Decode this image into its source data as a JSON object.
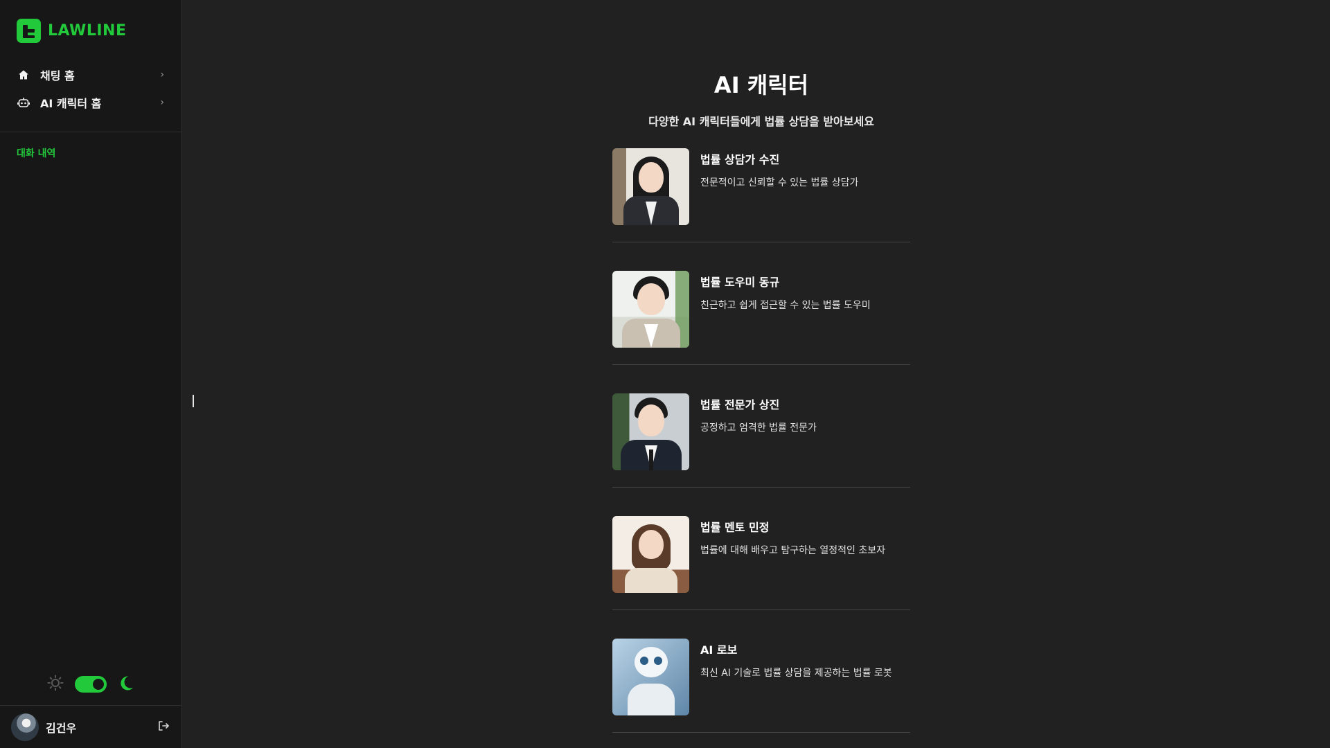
{
  "brand": {
    "name": "LAWLINE",
    "color": "#22c93b"
  },
  "sidebar": {
    "nav": [
      {
        "label": "채팅 홈",
        "icon": "home-icon"
      },
      {
        "label": "AI 캐릭터 홈",
        "icon": "robot-icon"
      }
    ],
    "history_label": "대화 내역",
    "theme": {
      "mode": "dark",
      "toggle_on": true
    }
  },
  "user": {
    "name": "김건우"
  },
  "main": {
    "title": "AI 캐릭터",
    "subtitle": "다양한 AI 캐릭터들에게 법률 상담을 받아보세요",
    "characters": [
      {
        "name": "법률 상담가 수진",
        "description": "전문적이고 신뢰할 수 있는 법률 상담가"
      },
      {
        "name": "법률 도우미 동규",
        "description": "친근하고 쉽게 접근할 수 있는 법률 도우미"
      },
      {
        "name": "법률 전문가 상진",
        "description": "공정하고 엄격한 법률 전문가"
      },
      {
        "name": "법률 멘토 민정",
        "description": "법률에 대해 배우고 탐구하는 열정적인 초보자"
      },
      {
        "name": "AI 로보",
        "description": "최신 AI 기술로 법률 상담을 제공하는 법률 로봇"
      }
    ]
  }
}
